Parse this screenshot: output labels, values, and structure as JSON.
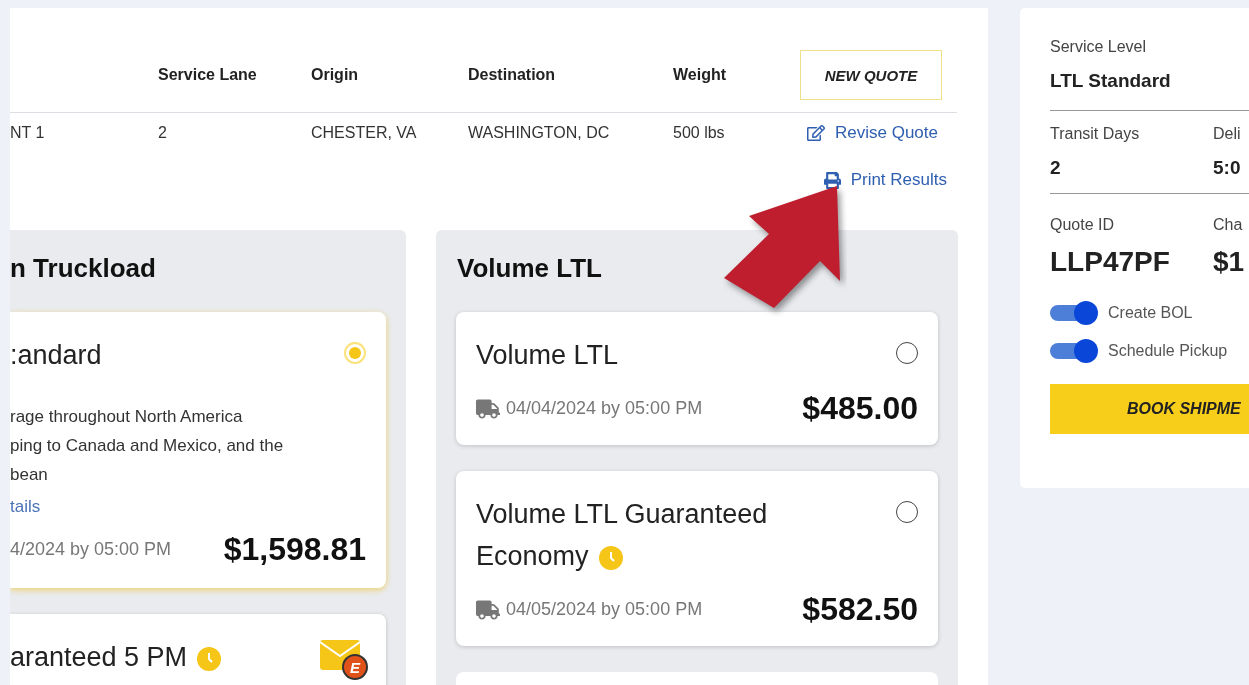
{
  "table": {
    "columns": [
      "",
      "Service Lane",
      "Origin",
      "Destination",
      "Weight"
    ],
    "rows": [
      {
        "cells": [
          "NT 1",
          "2",
          "CHESTER, VA",
          "WASHINGTON, DC",
          "500 lbs"
        ]
      }
    ]
  },
  "new_quote_button": "NEW QUOTE",
  "revise_quote_link": "Revise Quote",
  "print_results_link": "Print Results",
  "groups": [
    {
      "title": "n Truckload",
      "options": [
        {
          "name": ":andard",
          "selected": true,
          "description": [
            "rage throughout North America",
            "ping to Canada and Mexico, and the",
            "bean"
          ],
          "details_link": "tails",
          "delivery": "4/2024 by 05:00 PM",
          "price": "$1,598.81"
        },
        {
          "name": "aranteed 5 PM",
          "clock": true,
          "badge": "E"
        }
      ]
    },
    {
      "title": "Volume LTL",
      "options": [
        {
          "name": "Volume LTL",
          "selected": false,
          "delivery": "04/04/2024 by 05:00 PM",
          "truck": true,
          "price": "$485.00"
        },
        {
          "name": "Volume LTL Guaranteed Economy",
          "selected": false,
          "clock": true,
          "delivery": "04/05/2024 by 05:00 PM",
          "truck": true,
          "price": "$582.50"
        },
        {
          "kind": "stub"
        }
      ]
    }
  ],
  "summary": {
    "service_level": {
      "label": "Service Level",
      "value": "LTL Standard"
    },
    "rows": [
      [
        {
          "label": "Transit Days",
          "value": "2",
          "kind": "plain"
        },
        {
          "label": "Deli",
          "value": "5:0",
          "kind": "plain"
        }
      ],
      [
        {
          "label": "Quote ID",
          "value": "LLP47PF",
          "kind": "large"
        },
        {
          "label": "Cha",
          "value": "$1",
          "kind": "large"
        }
      ]
    ],
    "toggles": [
      {
        "label": "Create BOL",
        "on": true
      },
      {
        "label": "Schedule Pickup",
        "on": true
      }
    ],
    "book_button": "BOOK SHIPME"
  }
}
